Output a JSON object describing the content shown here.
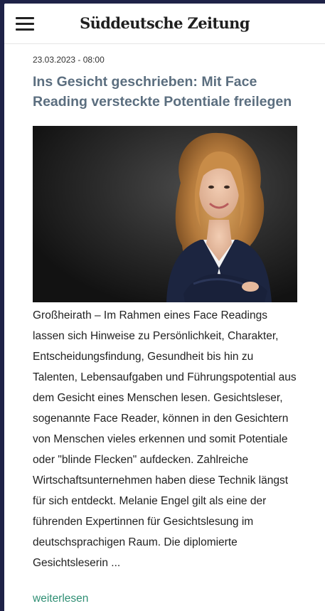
{
  "header": {
    "logo_text": "Süddeutsche Zeitung",
    "menu_icon": "hamburger-menu-icon"
  },
  "article": {
    "date": "23.03.2023 - 08:00",
    "title": "Ins Gesicht geschrieben: Mit Face Reading versteckte Potentiale freilegen",
    "body": "Großheirath – Im Rahmen eines Face Readings lassen sich Hinweise zu Persönlichkeit, Charakter, Entscheidungsfindung, Gesundheit bis hin zu Talenten, Lebensaufgaben und Führungspotential aus dem Gesicht eines Menschen lesen. Gesichtsleser, sogenannte Face Reader, können in den Gesichtern von Menschen vieles erkennen und somit Potentiale oder \"blinde Flecken\" aufdecken. Zahlreiche Wirtschaftsunternehmen haben diese Technik längst für sich entdeckt. Melanie Engel gilt als eine der führenden Expertinnen für Gesichtslesung im deutschsprachigen Raum. Die diplomierte Gesichtsleserin ...",
    "read_more": "weiterlesen"
  },
  "colors": {
    "frame_background": "#1e2247",
    "title": "#5b6e7f",
    "link": "#2f8f74"
  }
}
